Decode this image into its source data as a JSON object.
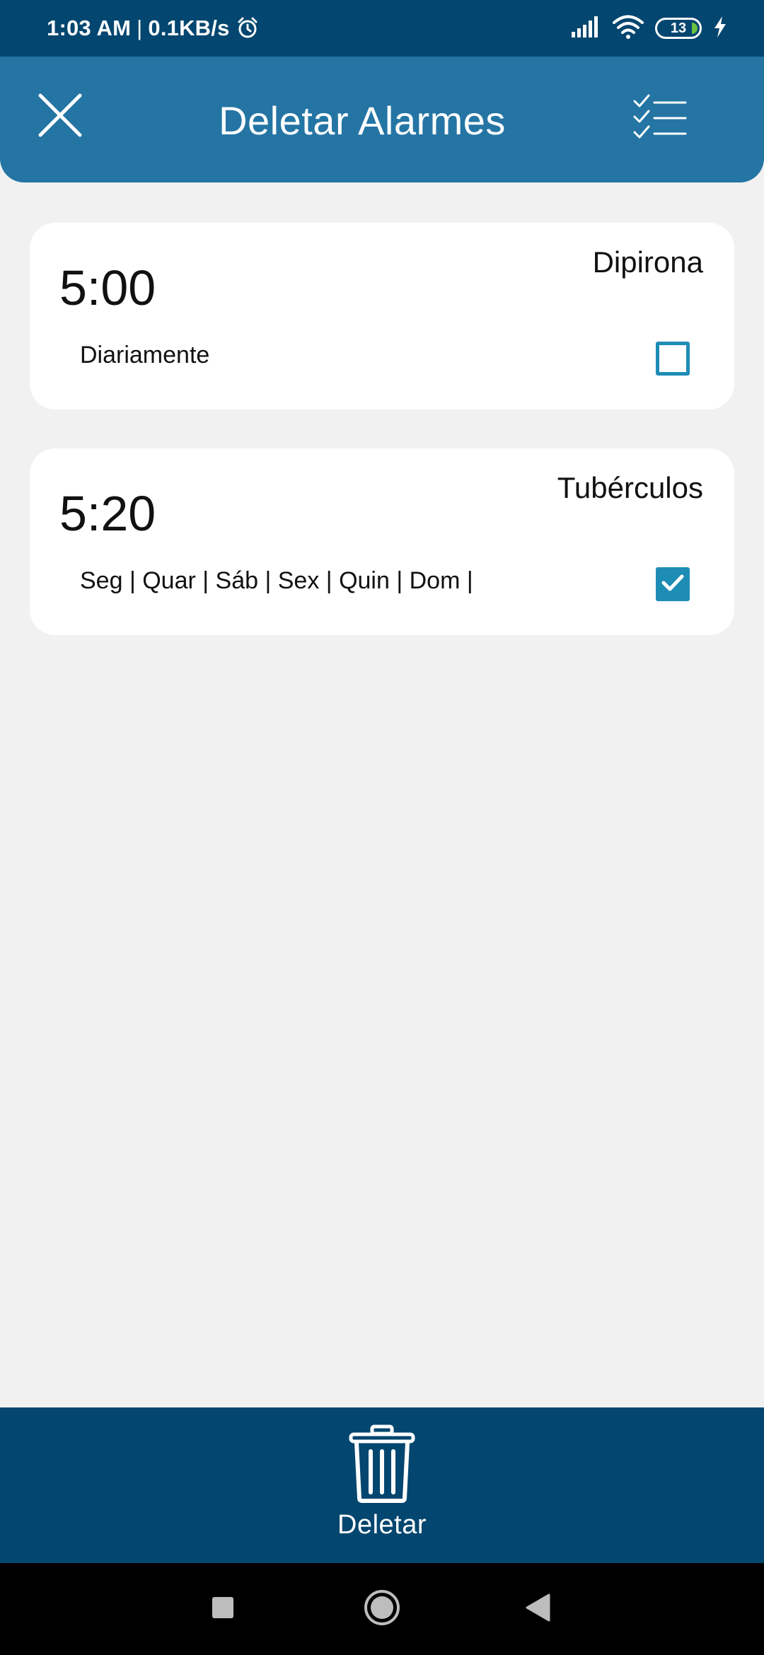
{
  "status_bar": {
    "time": "1:03 AM",
    "separator": "|",
    "speed": "0.1KB/s",
    "battery_level": "13",
    "icons": [
      "alarm-clock-icon",
      "signal-icon",
      "wifi-icon",
      "battery-icon",
      "charging-bolt-icon"
    ]
  },
  "app_bar": {
    "title": "Deletar Alarmes",
    "close_icon": "close-icon",
    "select_all_icon": "checklist-icon"
  },
  "alarms": [
    {
      "time": "5:00",
      "name": "Dipirona",
      "days": "Diariamente",
      "checked": false
    },
    {
      "time": "5:20",
      "name": "Tubérculos",
      "days": "Seg | Quar | Sáb | Sex | Quin | Dom |",
      "checked": true
    }
  ],
  "bottom_bar": {
    "delete_label": "Deletar",
    "delete_icon": "trash-icon"
  },
  "nav_bar": {
    "icons": [
      "recents-square-icon",
      "home-circle-icon",
      "back-triangle-icon"
    ]
  },
  "colors": {
    "status_bar": "#03466f",
    "app_bar": "#2475a4",
    "background": "#f1f1f1",
    "card": "#ffffff",
    "checkbox_accent": "#1e8db5",
    "bottom_bar": "#03466f",
    "nav_bar": "#000000"
  }
}
